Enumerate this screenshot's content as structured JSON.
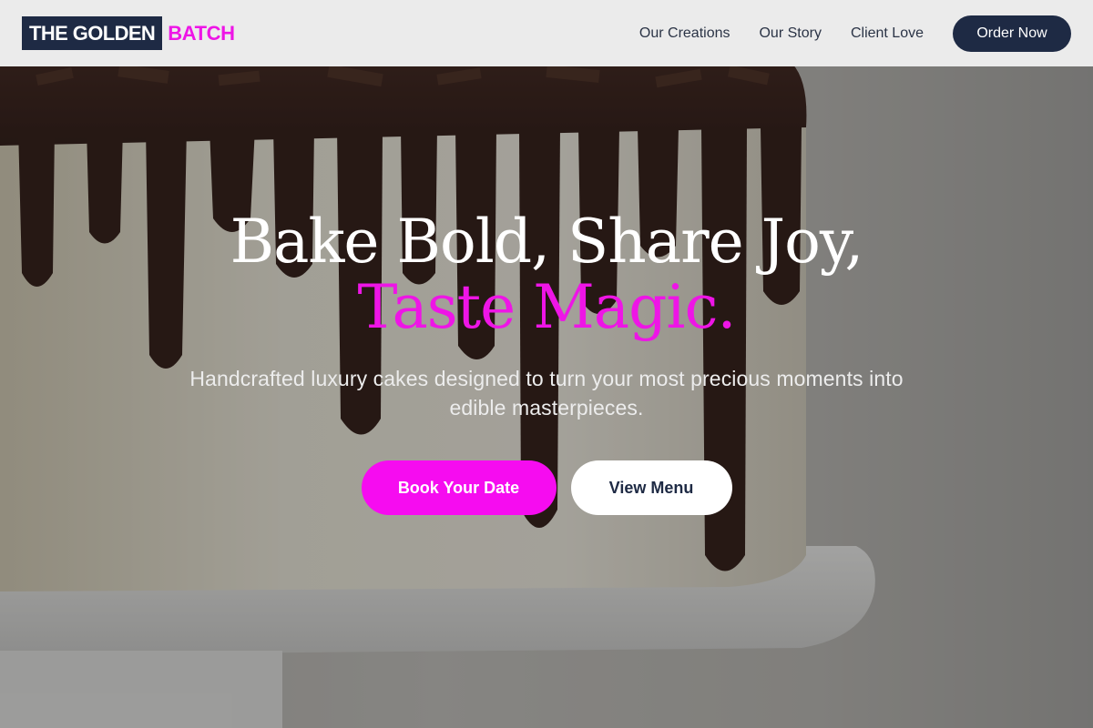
{
  "brand": {
    "name_main": "THE GOLDEN",
    "name_accent": "BATCH"
  },
  "nav": {
    "links": [
      {
        "label": "Our Creations"
      },
      {
        "label": "Our Story"
      },
      {
        "label": "Client Love"
      }
    ],
    "cta_label": "Order Now"
  },
  "hero": {
    "headline_line1": "Bake Bold, Share Joy,",
    "headline_line2": "Taste Magic.",
    "subtitle": "Handcrafted luxury cakes designed to turn your most precious moments into edible masterpieces.",
    "primary_button": "Book Your Date",
    "secondary_button": "View Menu",
    "background_image": "chocolate-drip-cake-photo"
  },
  "colors": {
    "navy": "#1e2a44",
    "accent_magenta": "#ee15e6",
    "nav_background": "#ebebeb"
  }
}
